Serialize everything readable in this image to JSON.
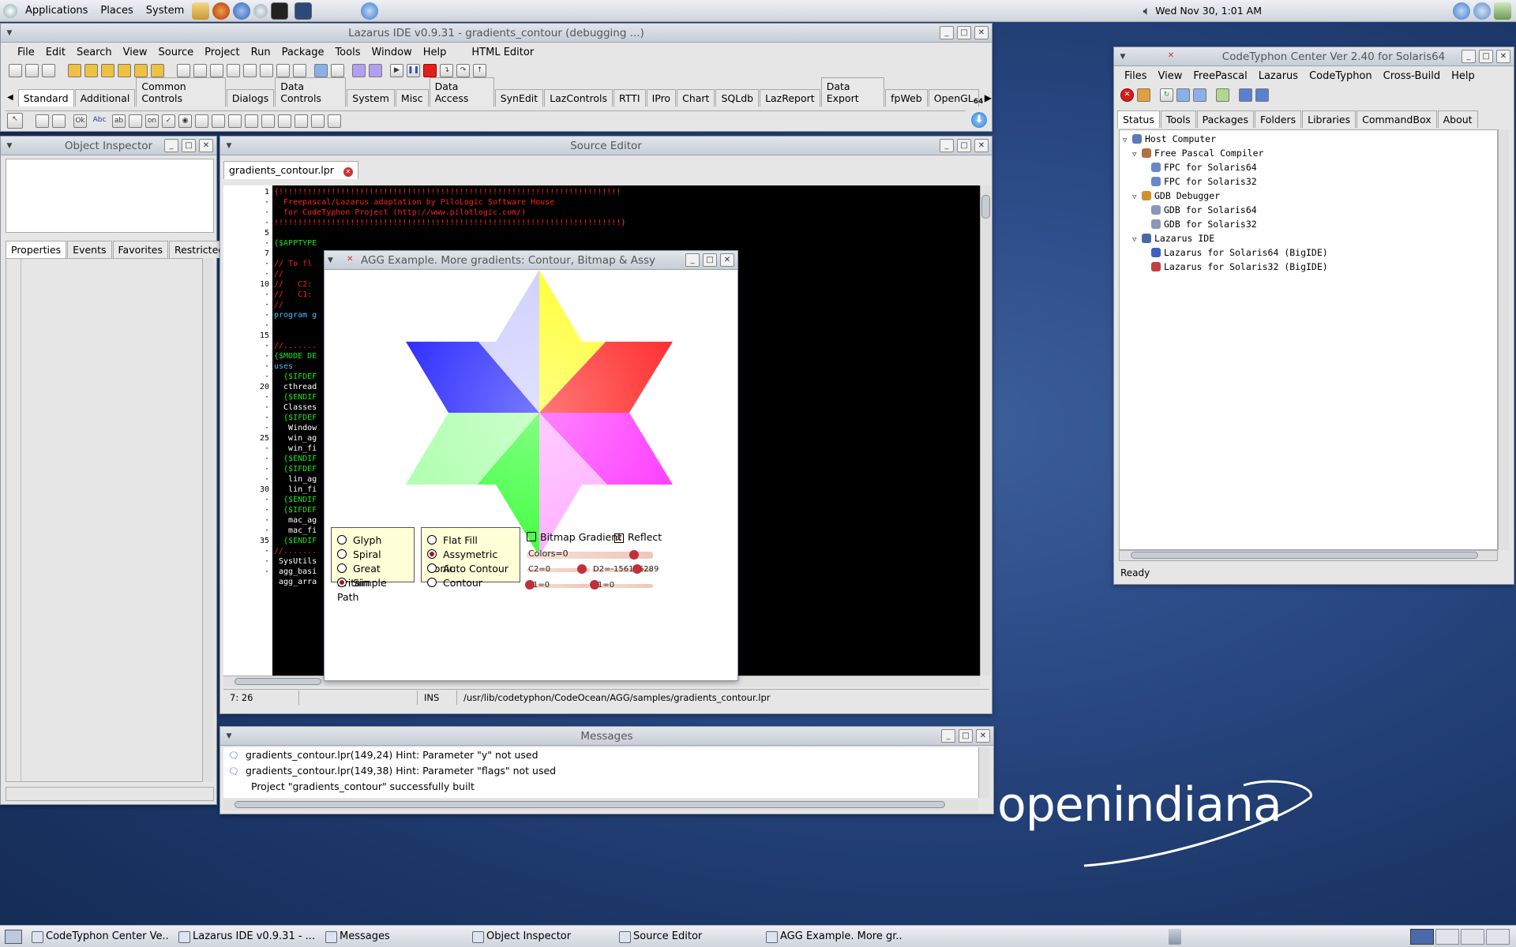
{
  "top_panel": {
    "menus": [
      "Applications",
      "Places",
      "System"
    ],
    "clock": "Wed Nov 30,  1:01 AM"
  },
  "ide": {
    "title": "Lazarus IDE v0.9.31 - gradients_contour (debugging ...)",
    "menu": [
      "File",
      "Edit",
      "Search",
      "View",
      "Source",
      "Project",
      "Run",
      "Package",
      "Tools",
      "Window",
      "Help",
      "HTML Editor"
    ],
    "palette_tabs": [
      "Standard",
      "Additional",
      "Common Controls",
      "Dialogs",
      "Data Controls",
      "System",
      "Misc",
      "Data Access",
      "SynEdit",
      "LazControls",
      "RTTI",
      "IPro",
      "Chart",
      "SQLdb",
      "LazReport",
      "Data Export",
      "fpWeb",
      "OpenGL"
    ],
    "arch_label": "64"
  },
  "inspector": {
    "title": "Object Inspector",
    "tabs": [
      "Properties",
      "Events",
      "Favorites",
      "Restricted"
    ]
  },
  "source_editor": {
    "title": "Source Editor",
    "file_tab": "gradients_contour.lpr",
    "gutter": [
      "1",
      "·",
      "·",
      "·",
      "5",
      "·",
      "7",
      "·",
      "·",
      "10",
      "·",
      "·",
      "·",
      "·",
      "15",
      "·",
      "·",
      "·",
      "·",
      "20",
      "·",
      "·",
      "·",
      "·",
      "25",
      "·",
      "·",
      "·",
      "·",
      "30",
      "·",
      "·",
      "·",
      "·",
      "35",
      "·",
      "·",
      "·"
    ],
    "code_lines": [
      "{!!!!!!!!!!!!!!!!!!!!!!!!!!!!!!!!!!!!!!!!!!!!!!!!!!!!!!!!!!!!!!!!!!!!!!!!",
      "  Freepascal/Lazarus adaptation by PiloLogic Software House",
      "  for CodeTyphon Project (http://www.pilotlogic.com/)",
      "!!!!!!!!!!!!!!!!!!!!!!!!!!!!!!!!!!!!!!!!!!!!!!!!!!!!!!!!!!!!!!!!!!!!!!!!!}",
      "",
      "{$APPTYPE",
      "",
      "// To fl",
      "//",
      "//   C2:",
      "//   C1:",
      "//",
      "program g",
      "",
      "",
      "//.......",
      "{$MODE DE",
      "uses",
      "  {$IFDEF",
      "  cthread",
      "  {$ENDIF",
      "  Classes",
      "  {$IFDEF",
      "   Window",
      "   win_ag",
      "   win_fi",
      "  {$ENDIF",
      "  {$IFDEF",
      "   lin_ag",
      "   lin_fi",
      "  {$ENDIF",
      "  {$IFDEF",
      "   mac_ag",
      "   mac_fi",
      "  {$ENDIF",
      "//.......",
      " SysUtils",
      " agg_basi",
      " agg_arra"
    ],
    "status_pos": "7: 26",
    "status_mode": "INS",
    "status_path": "/usr/lib/codetyphon/CodeOcean/AGG/samples/gradients_contour.lpr"
  },
  "agg": {
    "title": "AGG Example. More gradients: Contour, Bitmap & Assy",
    "group1": [
      {
        "label": "Glyph",
        "on": false
      },
      {
        "label": "Spiral",
        "on": false
      },
      {
        "label": "Great Britain",
        "on": false
      },
      {
        "label": "Simple Path",
        "on": true
      }
    ],
    "group2": [
      {
        "label": "Flat Fill",
        "on": false
      },
      {
        "label": "Assymetric Conic",
        "on": true
      },
      {
        "label": "Auto Contour",
        "on": false
      },
      {
        "label": "Contour",
        "on": false
      }
    ],
    "bitmap_gradient": "Bitmap Gradient",
    "reflect": "Reflect",
    "slider_colors": "Colors=0",
    "slider_c2": "C2=0",
    "slider_d2": "D2=-156186289",
    "slider_a": "1=0",
    "slider_b": "1=0"
  },
  "messages": {
    "title": "Messages",
    "lines": [
      "gradients_contour.lpr(149,24) Hint: Parameter \"y\" not used",
      "gradients_contour.lpr(149,38) Hint: Parameter \"flags\" not used",
      "Project \"gradients_contour\" successfully built"
    ]
  },
  "center": {
    "title": "CodeTyphon Center Ver 2.40 for Solaris64",
    "menu": [
      "Files",
      "View",
      "FreePascal",
      "Lazarus",
      "CodeTyphon",
      "Cross-Build",
      "Help"
    ],
    "tabs": [
      "Status",
      "Tools",
      "Packages",
      "Folders",
      "Libraries",
      "CommandBox",
      "About"
    ],
    "tree": [
      {
        "label": "Host Computer",
        "level": 0,
        "color": "#5a7ab8"
      },
      {
        "label": "Free Pascal Compiler",
        "level": 1,
        "color": "#b07040"
      },
      {
        "label": "FPC for Solaris64",
        "level": 2,
        "color": "#6a88c8"
      },
      {
        "label": "FPC for Solaris32",
        "level": 2,
        "color": "#6a88c8"
      },
      {
        "label": "GDB Debugger",
        "level": 1,
        "color": "#d09030"
      },
      {
        "label": "GDB for Solaris64",
        "level": 2,
        "color": "#8898b8"
      },
      {
        "label": "GDB for Solaris32",
        "level": 2,
        "color": "#8898b8"
      },
      {
        "label": "Lazarus IDE",
        "level": 1,
        "color": "#4a68a8"
      },
      {
        "label": "Lazarus for Solaris64 (BigIDE)",
        "level": 2,
        "color": "#3a60c0"
      },
      {
        "label": "Lazarus for Solaris32 (BigIDE)",
        "level": 2,
        "color": "#c04040"
      }
    ],
    "status": "Ready"
  },
  "wallpaper": {
    "brand": "openindiana"
  },
  "taskbar": [
    "CodeTyphon Center Ve...",
    "Lazarus IDE v0.9.31 - ...",
    "Messages",
    "Object Inspector",
    "Source Editor",
    "AGG Example. More gr..."
  ]
}
